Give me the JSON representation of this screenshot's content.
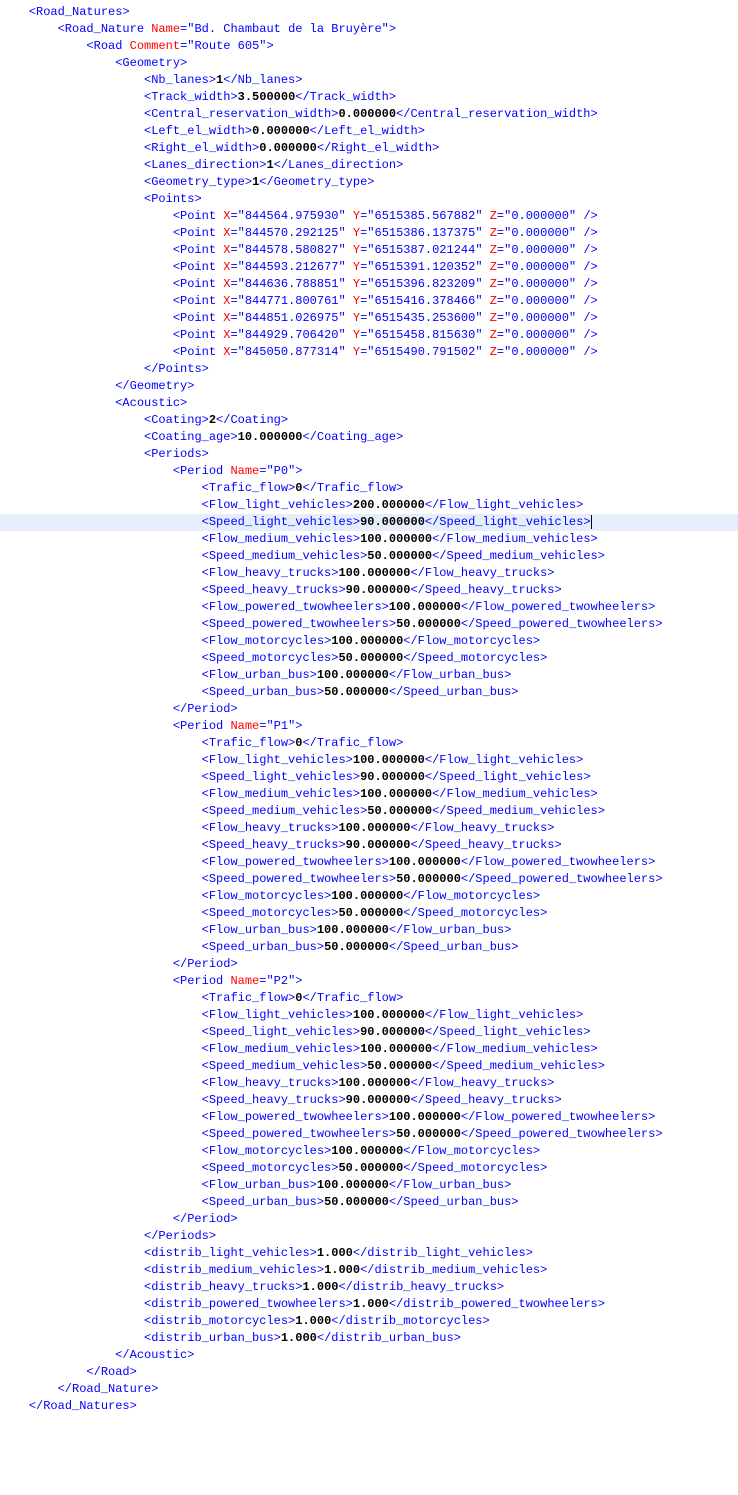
{
  "road_natures_tag": "Road_Natures",
  "road_nature_tag": "Road_Nature",
  "road_nature_name_attr": "Name",
  "road_nature_name_val": "Bd. Chambaut de la Bruyère",
  "road_tag": "Road",
  "road_comment_attr": "Comment",
  "road_comment_val": "Route 605",
  "geometry_tag": "Geometry",
  "nb_lanes_tag": "Nb_lanes",
  "nb_lanes_val": "1",
  "track_width_tag": "Track_width",
  "track_width_val": "3.500000",
  "crw_tag": "Central_reservation_width",
  "crw_val": "0.000000",
  "lew_tag": "Left_el_width",
  "lew_val": "0.000000",
  "rew_tag": "Right_el_width",
  "rew_val": "0.000000",
  "ldir_tag": "Lanes_direction",
  "ldir_val": "1",
  "gtype_tag": "Geometry_type",
  "gtype_val": "1",
  "points_tag": "Points",
  "point_tag": "Point",
  "x_attr": "X",
  "y_attr": "Y",
  "z_attr": "Z",
  "points": [
    {
      "x": "844564.975930",
      "y": "6515385.567882",
      "z": "0.000000"
    },
    {
      "x": "844570.292125",
      "y": "6515386.137375",
      "z": "0.000000"
    },
    {
      "x": "844578.580827",
      "y": "6515387.021244",
      "z": "0.000000"
    },
    {
      "x": "844593.212677",
      "y": "6515391.120352",
      "z": "0.000000"
    },
    {
      "x": "844636.788851",
      "y": "6515396.823209",
      "z": "0.000000"
    },
    {
      "x": "844771.800761",
      "y": "6515416.378466",
      "z": "0.000000"
    },
    {
      "x": "844851.026975",
      "y": "6515435.253600",
      "z": "0.000000"
    },
    {
      "x": "844929.706420",
      "y": "6515458.815630",
      "z": "0.000000"
    },
    {
      "x": "845050.877314",
      "y": "6515490.791502",
      "z": "0.000000"
    }
  ],
  "acoustic_tag": "Acoustic",
  "coating_tag": "Coating",
  "coating_val": "2",
  "coating_age_tag": "Coating_age",
  "coating_age_val": "10.000000",
  "periods_tag": "Periods",
  "period_tag": "Period",
  "name_attr": "Name",
  "trafic_flow_tag": "Trafic_flow",
  "flow_lv_tag": "Flow_light_vehicles",
  "speed_lv_tag": "Speed_light_vehicles",
  "flow_mv_tag": "Flow_medium_vehicles",
  "speed_mv_tag": "Speed_medium_vehicles",
  "flow_ht_tag": "Flow_heavy_trucks",
  "speed_ht_tag": "Speed_heavy_trucks",
  "flow_ptw_tag": "Flow_powered_twowheelers",
  "speed_ptw_tag": "Speed_powered_twowheelers",
  "flow_mc_tag": "Flow_motorcycles",
  "speed_mc_tag": "Speed_motorcycles",
  "flow_ub_tag": "Flow_urban_bus",
  "speed_ub_tag": "Speed_urban_bus",
  "periods": [
    {
      "name": "P0",
      "trafic_flow": "0",
      "flow_lv": "200.000000",
      "speed_lv": "90.000000",
      "flow_mv": "100.000000",
      "speed_mv": "50.000000",
      "flow_ht": "100.000000",
      "speed_ht": "90.000000",
      "flow_ptw": "100.000000",
      "speed_ptw": "50.000000",
      "flow_mc": "100.000000",
      "speed_mc": "50.000000",
      "flow_ub": "100.000000",
      "speed_ub": "50.000000"
    },
    {
      "name": "P1",
      "trafic_flow": "0",
      "flow_lv": "100.000000",
      "speed_lv": "90.000000",
      "flow_mv": "100.000000",
      "speed_mv": "50.000000",
      "flow_ht": "100.000000",
      "speed_ht": "90.000000",
      "flow_ptw": "100.000000",
      "speed_ptw": "50.000000",
      "flow_mc": "100.000000",
      "speed_mc": "50.000000",
      "flow_ub": "100.000000",
      "speed_ub": "50.000000"
    },
    {
      "name": "P2",
      "trafic_flow": "0",
      "flow_lv": "100.000000",
      "speed_lv": "90.000000",
      "flow_mv": "100.000000",
      "speed_mv": "50.000000",
      "flow_ht": "100.000000",
      "speed_ht": "90.000000",
      "flow_ptw": "100.000000",
      "speed_ptw": "50.000000",
      "flow_mc": "100.000000",
      "speed_mc": "50.000000",
      "flow_ub": "100.000000",
      "speed_ub": "50.000000"
    }
  ],
  "dlv_tag": "distrib_light_vehicles",
  "dlv_val": "1.000",
  "dmv_tag": "distrib_medium_vehicles",
  "dmv_val": "1.000",
  "dht_tag": "distrib_heavy_trucks",
  "dht_val": "1.000",
  "dptw_tag": "distrib_powered_twowheelers",
  "dptw_val": "1.000",
  "dmc_tag": "distrib_motorcycles",
  "dmc_val": "1.000",
  "dub_tag": "distrib_urban_bus",
  "dub_val": "1.000",
  "highlight_line_index": 30
}
